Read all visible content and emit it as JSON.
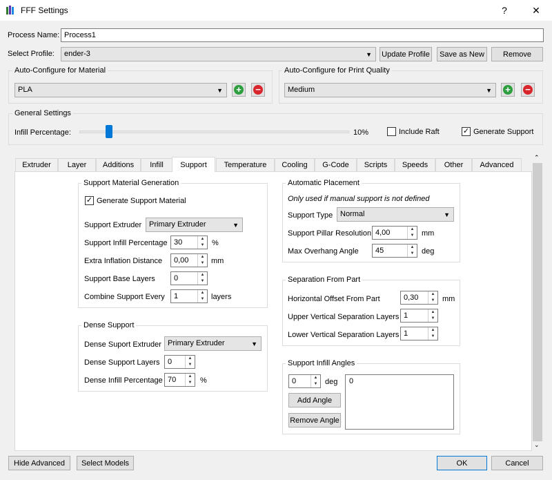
{
  "window": {
    "title": "FFF Settings",
    "help": "?",
    "close": "✕"
  },
  "process_name": {
    "label": "Process Name:",
    "value": "Process1"
  },
  "select_profile": {
    "label": "Select Profile:",
    "value": "ender-3",
    "update": "Update Profile",
    "save_new": "Save as New",
    "remove": "Remove"
  },
  "material": {
    "title": "Auto-Configure for Material",
    "value": "PLA"
  },
  "quality": {
    "title": "Auto-Configure for Print Quality",
    "value": "Medium"
  },
  "general": {
    "title": "General Settings",
    "infill_label": "Infill Percentage:",
    "infill_value": "10%",
    "infill_fraction": 0.1,
    "include_raft": "Include Raft",
    "generate_support": "Generate Support"
  },
  "tabs": [
    "Extruder",
    "Layer",
    "Additions",
    "Infill",
    "Support",
    "Temperature",
    "Cooling",
    "G-Code",
    "Scripts",
    "Speeds",
    "Other",
    "Advanced"
  ],
  "active_tab": "Support",
  "support_gen": {
    "title": "Support Material Generation",
    "generate_label": "Generate Support Material",
    "extruder_label": "Support Extruder",
    "extruder_value": "Primary Extruder",
    "infill_label": "Support Infill Percentage",
    "infill_value": "30",
    "infill_unit": "%",
    "inflation_label": "Extra Inflation Distance",
    "inflation_value": "0,00",
    "inflation_unit": "mm",
    "base_label": "Support Base Layers",
    "base_value": "0",
    "combine_label": "Combine Support Every",
    "combine_value": "1",
    "combine_unit": "layers"
  },
  "dense": {
    "title": "Dense Support",
    "extruder_label": "Dense Suport Extruder",
    "extruder_value": "Primary Extruder",
    "layers_label": "Dense Support Layers",
    "layers_value": "0",
    "infill_label": "Dense Infill Percentage",
    "infill_value": "70",
    "infill_unit": "%"
  },
  "auto_place": {
    "title": "Automatic Placement",
    "note": "Only used if manual support is not defined",
    "type_label": "Support Type",
    "type_value": "Normal",
    "pillar_label": "Support Pillar Resolution",
    "pillar_value": "4,00",
    "pillar_unit": "mm",
    "overhang_label": "Max Overhang Angle",
    "overhang_value": "45",
    "overhang_unit": "deg"
  },
  "separation": {
    "title": "Separation From Part",
    "horiz_label": "Horizontal Offset From Part",
    "horiz_value": "0,30",
    "horiz_unit": "mm",
    "upper_label": "Upper Vertical Separation Layers",
    "upper_value": "1",
    "lower_label": "Lower Vertical Separation Layers",
    "lower_value": "1"
  },
  "angles": {
    "title": "Support Infill Angles",
    "angle_value": "0",
    "angle_unit": "deg",
    "add": "Add Angle",
    "remove": "Remove Angle",
    "list": "0"
  },
  "footer": {
    "hide_adv": "Hide Advanced",
    "select_models": "Select Models",
    "ok": "OK",
    "cancel": "Cancel"
  }
}
